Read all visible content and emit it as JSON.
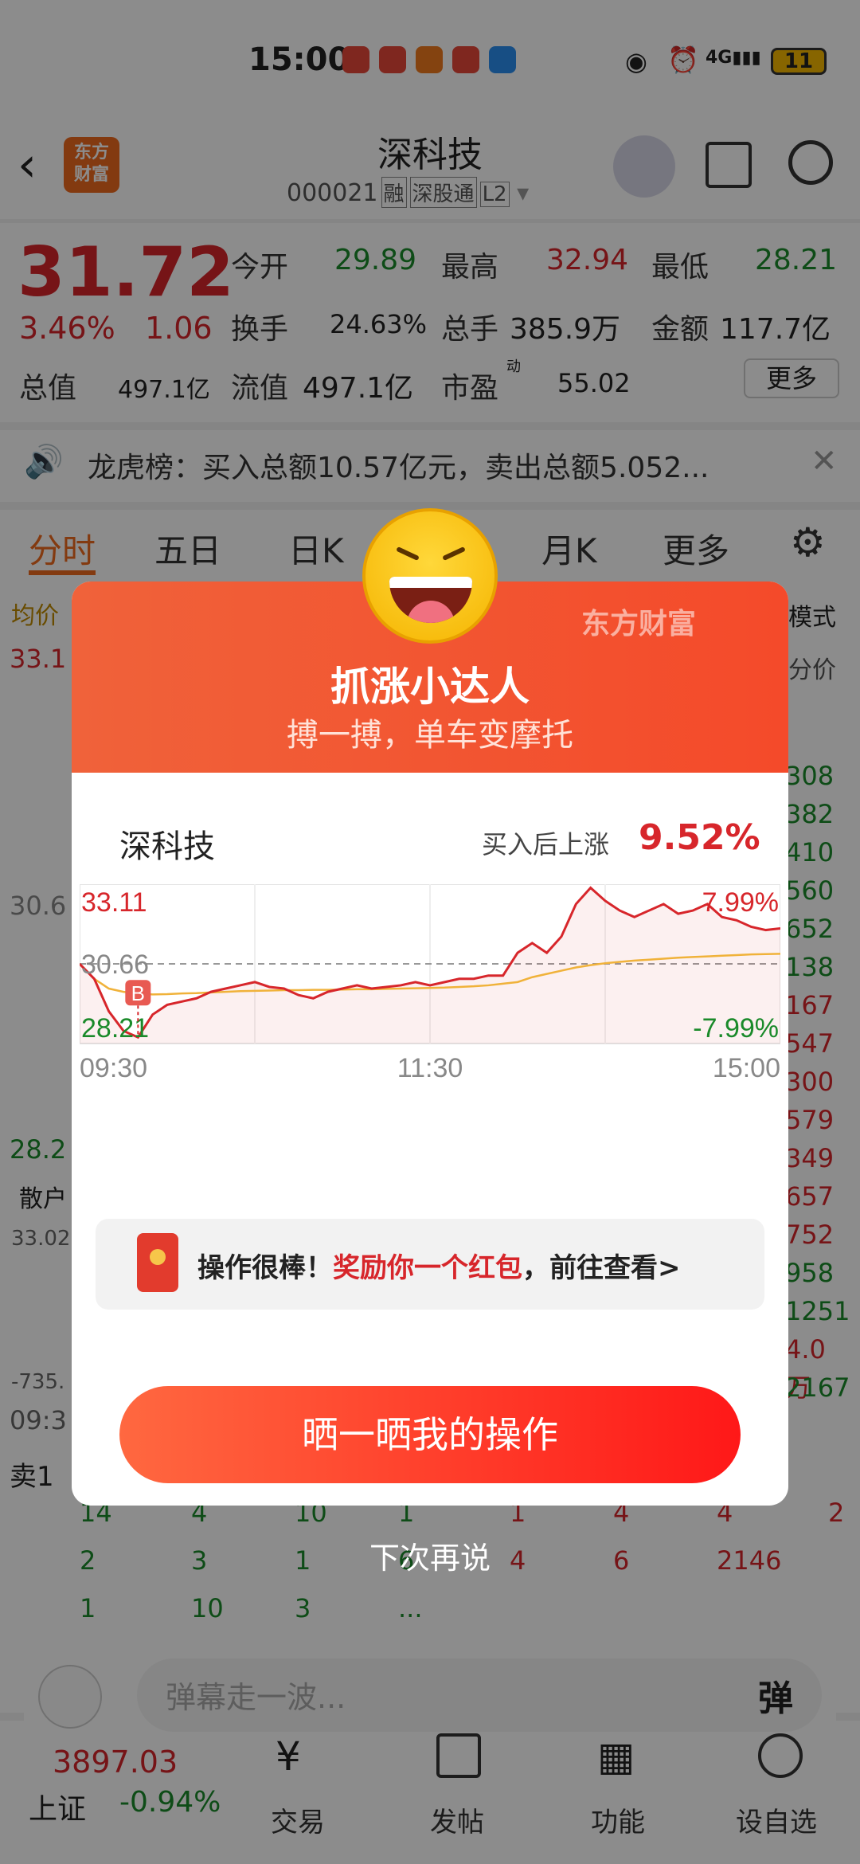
{
  "status": {
    "time": "15:00",
    "battery": "11"
  },
  "header": {
    "title": "深科技",
    "code": "000021",
    "tags": [
      "融",
      "深股通",
      "L2"
    ],
    "logo": "东方\n财富"
  },
  "quote": {
    "price": "31.72",
    "pct": "3.46%",
    "chg": "1.06",
    "open_label": "今开",
    "open": "29.89",
    "high_label": "最高",
    "high": "32.94",
    "low_label": "最低",
    "low": "28.21",
    "turnover_label": "换手",
    "turnover": "24.63%",
    "volume_label": "总手",
    "volume": "385.9万",
    "amount_label": "金额",
    "amount": "117.7亿",
    "mktcap_label": "总值",
    "mktcap": "497.1亿",
    "float_label": "流值",
    "float": "497.1亿",
    "pe_label": "市盈",
    "pe_sup": "动",
    "pe": "55.02",
    "more": "更多"
  },
  "notice": {
    "text": "龙虎榜：买入总额10.57亿元，卖出总额5.052..."
  },
  "tabs": [
    "分时",
    "五日",
    "日K",
    "月K",
    "更多"
  ],
  "bg": {
    "avg_label": "均价",
    "price_top": "33.1",
    "price_mid": "30.6",
    "price_low": "28.2",
    "retail": "散户",
    "vol": "33.02",
    "neg": "-735.",
    "time0": "09:3",
    "sell1": "卖1",
    "mode": "模式",
    "fenjia": "分价",
    "right_vals": [
      "308",
      "382",
      "410",
      "560",
      "652",
      "138",
      "167",
      "547",
      "300",
      "579",
      "349",
      "657",
      "752",
      "958",
      "1251",
      "4.0万",
      "2167"
    ],
    "row1": [
      "14",
      "4",
      "10",
      "1",
      "1",
      "4",
      "4",
      "2"
    ],
    "row2": [
      "2",
      "3",
      "1",
      "6",
      "4",
      "6",
      "2146"
    ],
    "row3": [
      "1",
      "10",
      "3",
      "..."
    ]
  },
  "bottom": {
    "index_val": "3897.03",
    "index_name": "上证",
    "index_chg": "-0.94%",
    "danmu_placeholder": "弹幕走一波...",
    "danmu_btn": "弹",
    "nav": [
      "交易",
      "发帖",
      "功能",
      "设自选"
    ]
  },
  "dialog": {
    "brand": "东方财富",
    "title": "抓涨小达人",
    "subtitle": "搏一搏，单车变摩托",
    "stock": "深科技",
    "rise_label": "买入后上涨",
    "rise_value": "9.52%",
    "redpack_prefix": "操作很棒！",
    "redpack_highlight": "奖励你一个红包",
    "redpack_suffix": "，前往查看>",
    "share_button": "晒一晒我的操作",
    "later": "下次再说"
  },
  "chart_data": {
    "type": "line",
    "ylim": [
      28.21,
      33.11
    ],
    "y_labels": [
      "33.11",
      "30.66",
      "28.21"
    ],
    "pct_labels": [
      "7.99%",
      "-7.99%"
    ],
    "x_labels": [
      "09:30",
      "11:30",
      "15:00"
    ],
    "buy_marker": "B",
    "x": [
      0,
      5,
      10,
      15,
      20,
      25,
      30,
      35,
      40,
      45,
      50,
      55,
      60,
      65,
      70,
      75,
      80,
      85,
      90,
      95,
      100,
      105,
      110,
      115,
      120,
      125,
      130,
      135,
      140,
      145,
      150,
      155,
      160,
      165,
      170,
      175,
      180,
      185,
      190,
      195,
      200,
      205,
      210,
      215,
      220,
      225,
      230,
      235,
      240
    ],
    "price": [
      30.66,
      30.2,
      29.2,
      28.6,
      28.4,
      29.1,
      29.4,
      29.5,
      29.6,
      29.8,
      29.9,
      30.0,
      30.1,
      29.95,
      29.9,
      29.7,
      29.6,
      29.8,
      29.9,
      30.0,
      29.9,
      29.95,
      30.0,
      30.1,
      30.0,
      30.1,
      30.2,
      30.2,
      30.3,
      30.3,
      31.0,
      31.3,
      31.0,
      31.5,
      32.5,
      33.0,
      32.6,
      32.3,
      32.1,
      32.3,
      32.5,
      32.2,
      32.3,
      32.5,
      32.1,
      32.0,
      31.8,
      31.7,
      31.75
    ],
    "avg": [
      30.66,
      30.2,
      29.9,
      29.8,
      29.75,
      29.72,
      29.73,
      29.75,
      29.76,
      29.78,
      29.8,
      29.82,
      29.83,
      29.84,
      29.85,
      29.85,
      29.86,
      29.86,
      29.87,
      29.88,
      29.88,
      29.89,
      29.9,
      29.91,
      29.92,
      29.93,
      29.95,
      29.97,
      30.0,
      30.05,
      30.1,
      30.25,
      30.35,
      30.45,
      30.55,
      30.62,
      30.68,
      30.72,
      30.76,
      30.79,
      30.82,
      30.85,
      30.87,
      30.89,
      30.91,
      30.93,
      30.95,
      30.96,
      30.97
    ]
  }
}
